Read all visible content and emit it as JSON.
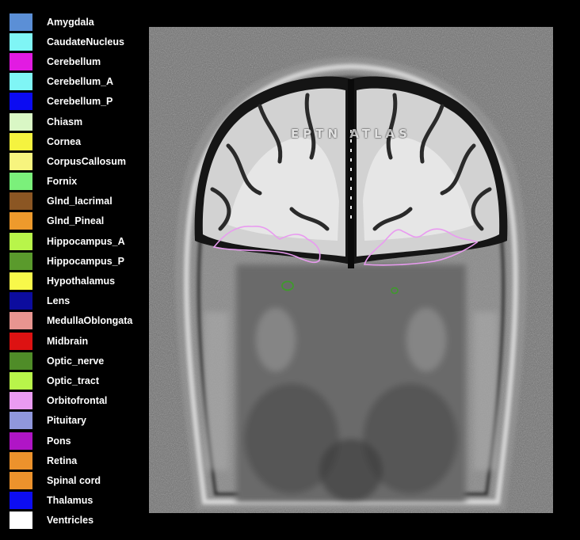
{
  "legend": {
    "items": [
      {
        "label": "Amygdala",
        "color": "#5b8fd6"
      },
      {
        "label": "CaudateNucleus",
        "color": "#7ff5f5"
      },
      {
        "label": "Cerebellum",
        "color": "#e21be2"
      },
      {
        "label": "Cerebellum_A",
        "color": "#7ff5f5"
      },
      {
        "label": "Cerebellum_P",
        "color": "#0b0bf2"
      },
      {
        "label": "Chiasm",
        "color": "#d9f7c5"
      },
      {
        "label": "Cornea",
        "color": "#f5f33f"
      },
      {
        "label": "CorpusCallosum",
        "color": "#f7f47e"
      },
      {
        "label": "Fornix",
        "color": "#7bf07b"
      },
      {
        "label": "Glnd_lacrimal",
        "color": "#8b5623"
      },
      {
        "label": "Glnd_Pineal",
        "color": "#ee9a2c"
      },
      {
        "label": "Hippocampus_A",
        "color": "#b8f54a"
      },
      {
        "label": "Hippocampus_P",
        "color": "#5a9a2c"
      },
      {
        "label": "Hypothalamus",
        "color": "#f8f84a"
      },
      {
        "label": "Lens",
        "color": "#0c0c9e"
      },
      {
        "label": "MedullaOblongata",
        "color": "#e89590"
      },
      {
        "label": "Midbrain",
        "color": "#dd1212"
      },
      {
        "label": "Optic_nerve",
        "color": "#4f8c28"
      },
      {
        "label": "Optic_tract",
        "color": "#b8f54a"
      },
      {
        "label": "Orbitofrontal",
        "color": "#ea9bf2"
      },
      {
        "label": "Pituitary",
        "color": "#9097dc"
      },
      {
        "label": "Pons",
        "color": "#b015c6"
      },
      {
        "label": "Retina",
        "color": "#ec922c"
      },
      {
        "label": "Spinal cord",
        "color": "#ec922c"
      },
      {
        "label": "Thalamus",
        "color": "#0d0df2"
      },
      {
        "label": "Ventricles",
        "color": "#ffffff"
      }
    ]
  },
  "image": {
    "watermark": "EPTN ATLAS",
    "contour_colors": {
      "orbitofrontal": "#e99bf0",
      "optic_nerve": "#3f9a2c"
    }
  }
}
